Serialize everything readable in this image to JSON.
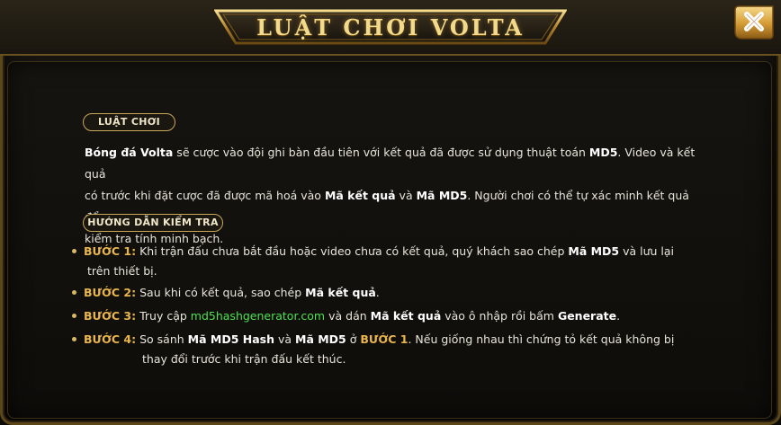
{
  "title": "LUẬT CHƠI VOLTA",
  "close_icon": "close-icon",
  "colors": {
    "gold": "#c9a757",
    "step_label": "#e8b54a",
    "link": "#4ee04e",
    "text": "#e8e4da"
  },
  "rules_section": {
    "heading": "LUẬT CHƠI",
    "p1_bold1": "Bóng đá Volta",
    "p1_t1": " sẽ cược vào đội ghi bàn đầu tiên với kết quả đã được sử dụng thuật toán ",
    "p1_bold2": "MD5",
    "p1_t2": ". Video và kết quả",
    "p2_t1": "có trước khi đặt cược đã được mã hoá vào ",
    "p2_bold1": "Mã kết quả",
    "p2_t2": " và ",
    "p2_bold2": "Mã MD5",
    "p2_t3": ". Người chơi có thể tự xác minh kết quả để",
    "p3_t1": "kiểm tra tính minh bạch."
  },
  "guide_section": {
    "heading": "HƯỚNG DẪN KIỂM TRA",
    "step1": {
      "label": "BƯỚC 1:",
      "t1": " Khi trận đấu chưa bắt đầu hoặc video chưa có kết quả, quý khách sao chép ",
      "b1": "Mã MD5",
      "t2": " và lưu lại",
      "t3": "trên thiết bị."
    },
    "step2": {
      "label": "BƯỚC 2:",
      "t1": " Sau khi có kết quả, sao chép ",
      "b1": "Mã kết quả",
      "t2": "."
    },
    "step3": {
      "label": "BƯỚC 3:",
      "t1": " Truy cập ",
      "link": "md5hashgenerator.com",
      "t2": " và dán ",
      "b1": "Mã kết quả",
      "t3": " vào ô nhập rồi bấm ",
      "b2": "Generate",
      "t4": "."
    },
    "step4": {
      "label": "BƯỚC 4:",
      "t1": " So sánh ",
      "b1": "Mã MD5 Hash",
      "t2": " và ",
      "b2": "Mã MD5",
      "t3": " ở ",
      "ref": "BƯỚC 1",
      "t4": ". Nếu giống nhau thì chứng tỏ kết quả không bị",
      "t5": "thay đổi trước khi trận đấu kết thúc."
    }
  }
}
